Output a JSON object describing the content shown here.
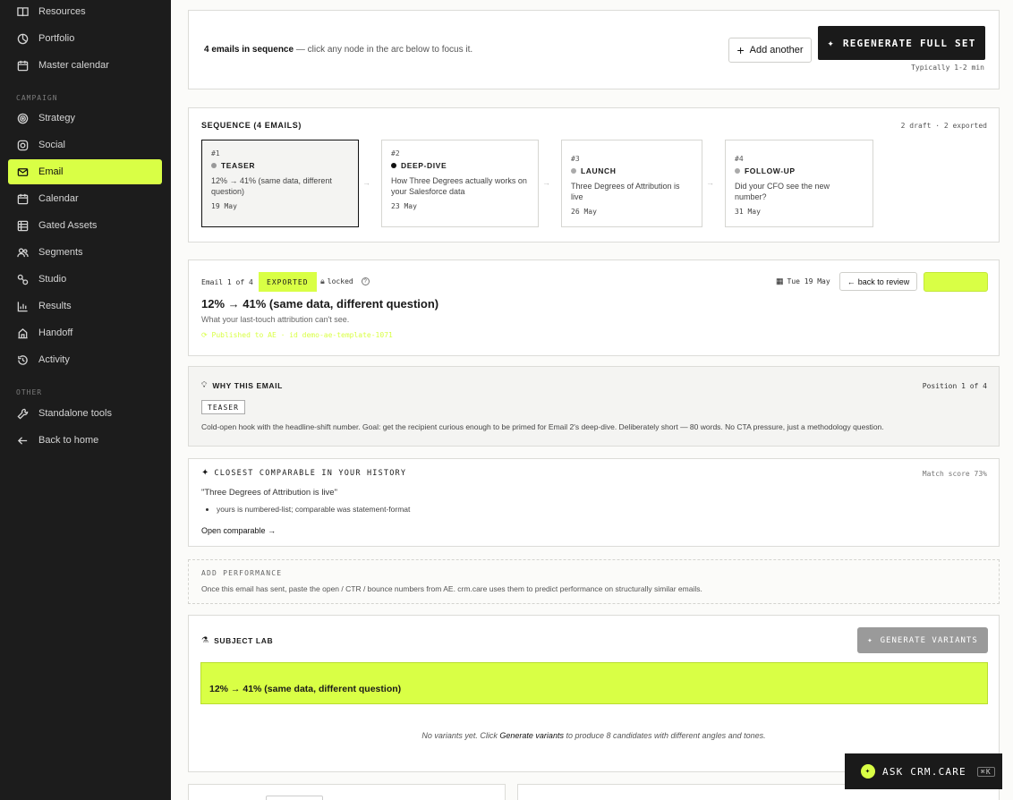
{
  "sidebar": {
    "top_items": [
      {
        "label": "Resources",
        "icon": "book-icon"
      },
      {
        "label": "Portfolio",
        "icon": "portfolio-icon"
      },
      {
        "label": "Master calendar",
        "icon": "calendar-icon"
      }
    ],
    "campaign_heading": "CAMPAIGN",
    "campaign_items": [
      {
        "label": "Strategy",
        "icon": "target-icon"
      },
      {
        "label": "Social",
        "icon": "social-icon"
      },
      {
        "label": "Email",
        "icon": "mail-icon",
        "active": true
      },
      {
        "label": "Calendar",
        "icon": "calendar-icon"
      },
      {
        "label": "Gated Assets",
        "icon": "gated-assets-icon"
      },
      {
        "label": "Segments",
        "icon": "users-icon"
      },
      {
        "label": "Studio",
        "icon": "studio-icon"
      },
      {
        "label": "Results",
        "icon": "bar-chart-icon"
      },
      {
        "label": "Handoff",
        "icon": "handoff-icon"
      },
      {
        "label": "Activity",
        "icon": "history-icon"
      }
    ],
    "other_heading": "OTHER",
    "other_items": [
      {
        "label": "Standalone tools",
        "icon": "wrench-icon"
      },
      {
        "label": "Back to home",
        "icon": "arrow-left-icon"
      }
    ]
  },
  "top_card": {
    "count_strong": "4 emails in sequence",
    "count_rest": " — click any node in the arc below to focus it.",
    "add_label": "Add another",
    "regen_label": "REGENERATE FULL SET",
    "regen_hint": "Typically 1-2 min"
  },
  "sequence": {
    "title": "SEQUENCE (4 EMAILS)",
    "status": "2 draft · 2 exported",
    "nodes": [
      {
        "num": "#1",
        "tag": "TEASER",
        "desc": "12% → 41% (same data, different question)",
        "date": "19 May",
        "dot": "#999999"
      },
      {
        "num": "#2",
        "tag": "DEEP-DIVE",
        "desc": "How Three Degrees actually works on your Salesforce data",
        "date": "23 May",
        "dot": "#111111"
      },
      {
        "num": "#3",
        "tag": "LAUNCH",
        "desc": "Three Degrees of Attribution is live",
        "date": "26 May",
        "dot": "#aaaaaa"
      },
      {
        "num": "#4",
        "tag": "FOLLOW-UP",
        "desc": "Did your CFO see the new number?",
        "date": "31 May",
        "dot": "#aaaaaa"
      }
    ]
  },
  "email_detail": {
    "position": "Email 1 of 4",
    "badge": "EXPORTED",
    "locked": "locked",
    "date": "Tue 19 May",
    "back_label": "back to review",
    "subject": "12% → 41% (same data, different question)",
    "preheader": "What your last-touch attribution can't see.",
    "published": "Published to AE · id demo-ae-template-1071"
  },
  "why": {
    "title": "WHY THIS EMAIL",
    "position": "Position 1 of 4",
    "tag": "TEASER",
    "body": "Cold-open hook with the headline-shift number. Goal: get the recipient curious enough to be primed for Email 2's deep-dive. Deliberately short — 80 words. No CTA pressure, just a methodology question."
  },
  "comparable": {
    "title": "CLOSEST COMPARABLE IN YOUR HISTORY",
    "match": "Match score 73%",
    "quote": "\"Three Degrees of Attribution is live\"",
    "bullet": "yours is numbered-list; comparable was statement-format",
    "link": "Open comparable"
  },
  "performance": {
    "title": "ADD PERFORMANCE",
    "body": "Once this email has sent, paste the open / CTR / bounce numbers from AE. crm.care uses them to predict performance on structurally similar emails."
  },
  "subject_lab": {
    "title": "SUBJECT LAB",
    "generate_label": "GENERATE VARIANTS",
    "current": "12% → 41% (same data, different question)",
    "empty_pre": "No variants yet. Click ",
    "empty_em": "Generate variants",
    "empty_post": " to produce 8 candidates with different angles and tones."
  },
  "ask": {
    "label": "ASK CRM.CARE",
    "shortcut": "⌘K"
  },
  "colors": {
    "accent": "#d9ff45",
    "dark": "#1a1a1a"
  }
}
